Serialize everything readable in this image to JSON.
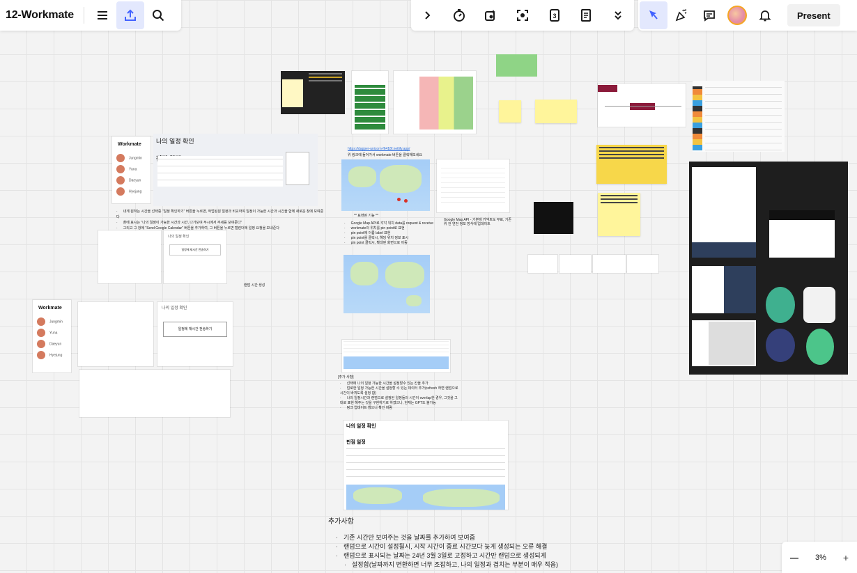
{
  "board": {
    "title": "12-Workmate"
  },
  "toolbar": {
    "present_label": "Present"
  },
  "zoom": {
    "level": "3%",
    "minus": "—"
  },
  "frames": {
    "schedule_check_title": "나의 일정 확인",
    "recommended_title": "핀점 일정",
    "brand": "Workmate",
    "users": [
      "Jungmin",
      "Yuna",
      "Daeyun",
      "Hyejung"
    ],
    "confirm_button": "일정 확인하기",
    "send_button": "일정에 재시간 전송하기",
    "random_label": "랜덤 시간 생성"
  },
  "notes_main": [
    "내게 원하는 시간을 선택중 \"일정 확인하기\" 버튼을 누르면, 작업된원 일정과 비교하여 일정이 가능한 시간과 시간을 함께 새로운 창에 보여준다",
    "창에 표시는 \"나의 일정이 가능한 시간과 시간, 나가보여 무시에서 추세를 보여준다\"",
    "그리고 그 창에 \"Send Google Calendar\" 버튼을 추가하여, 그 버튼을 누르면 캘린더에 일정 요청을 보내준다"
  ],
  "link_text": "https://dapper-unicorn-f6418f.netlify.app/",
  "link_caption": "위 링크에 들어가서 workmate 버튼을 클릭해보세요",
  "map_section": {
    "heading": "** 표현된 기능 **",
    "items": [
      "Google Map API로 각각 위치 data를 request & receive",
      "workmate의 위치를 pin point로 표현",
      "pin point에 이름 label 표현",
      "pin point를 클릭시, 해당 위치 정보 표시",
      "pin point 클릭시, 확대된 화면으로 이동"
    ]
  },
  "google_caption": "Google Map API - 기본에 커넥트도 무료, 기존 위 한 연번 정보 방식에 업데이트",
  "additions_title": "추가사항",
  "additions": [
    "기존 시간만 보여주는 것을 날짜를 추가하여 보여줌",
    "랜덤으로 시간이 설정될시, 시작 시간이 종료 시간보다 늦게 생성되는 오류 해결",
    "랜덤으로 표시되는 날짜는 24년 3월 3일로 고정하고 시간만 랜덤으로 생성되게",
    "설정함(날짜까지 변환하면 너무 조잡하고, 나의 일정과 겹치는 부분이 매우 적음)"
  ],
  "extra_title": "[추가 사항]",
  "extra_items": [
    "선택에 나의 일정 가능한 시간을 설정할수 있는 칸을 추가",
    "업로한 일정 가능한 시간을 설정할 수 있는 데이터 추가(refresh 하면 랜덤으로 시간이 바뀌도록 설정 함)",
    "나의 일정시간과 랜덤으로 설정된 일정들의 시간이 overlap한 경우, 그것을 그대로 표현 해주는 것을 구현하기로 하였으나, 현재는 GPT도 불가능",
    "핑크 업데이트 했으니 확인 바람"
  ],
  "table_preview": {
    "title": "나의 일정 확인",
    "subtitle": "핀점 일정"
  },
  "colors": {
    "accent": "#4262ff",
    "sticky_yellow": "#fff59b",
    "sticky_orange": "#f7d74a",
    "sticky_green": "#8fd486",
    "dark_frame": "#1e1e1e"
  }
}
